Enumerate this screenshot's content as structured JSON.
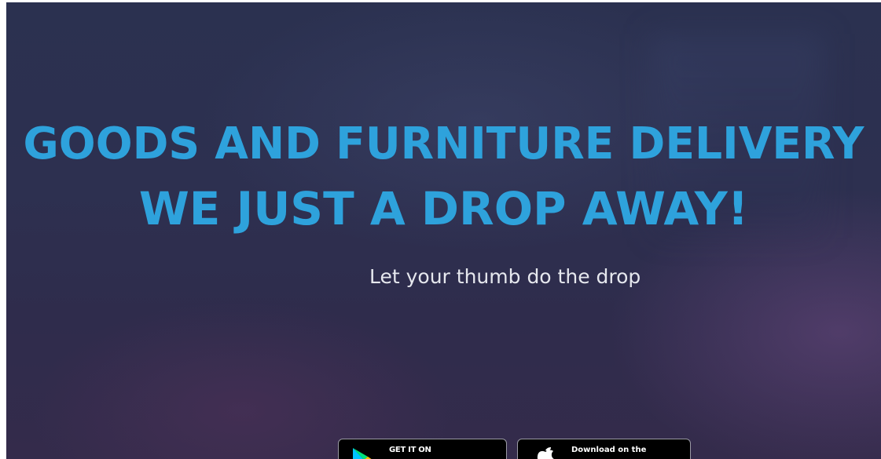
{
  "hero": {
    "headline_line1": "GOODS AND FURNITURE DELIVERY",
    "headline_line2": "WE JUST A DROP AWAY!",
    "subtitle": "Let your thumb do the drop"
  },
  "store_badges": {
    "google": {
      "small_label": "GET IT ON",
      "icon": "google-play-icon"
    },
    "apple": {
      "small_label": "Download on the",
      "icon": "apple-icon"
    }
  },
  "colors": {
    "headline": "#2ea2dc",
    "subtitle": "#e6e8ee",
    "background": "#2d3050"
  }
}
